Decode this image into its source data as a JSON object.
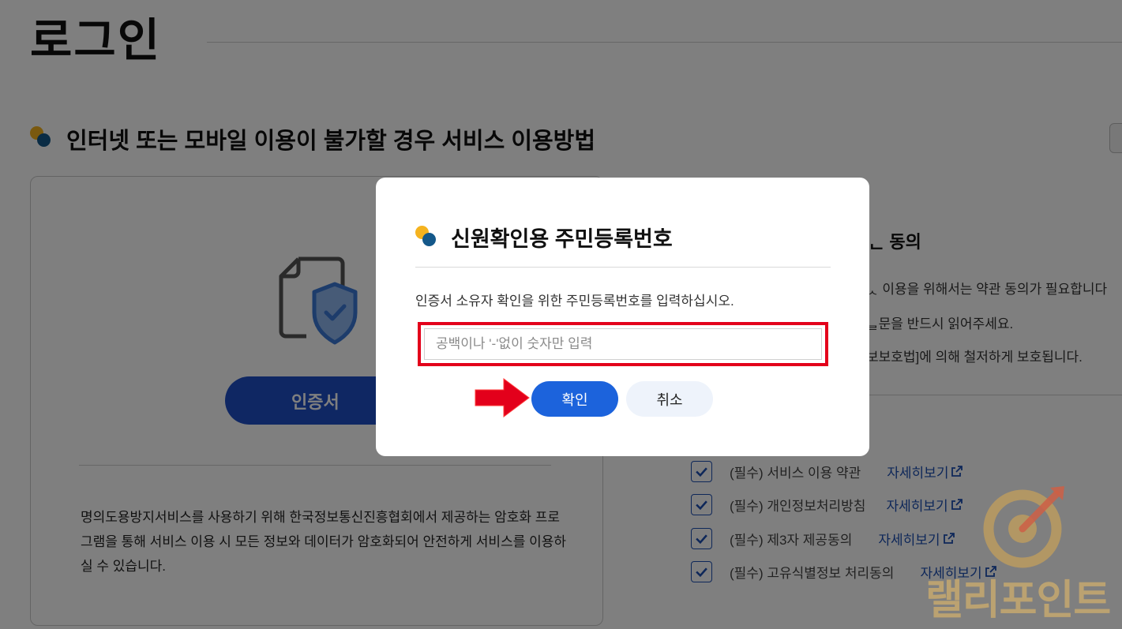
{
  "page": {
    "title": "로그인",
    "section_title": "인터넷 또는 모바일 이용이 불가할 경우 서비스 이용방법"
  },
  "left_card": {
    "button_label": "인증서",
    "description": "명의도용방지서비스를 사용하기 위해 한국정보통신진흥협회에서 제공하는 암호화 프로그램을 통해 서비스 이용 시 모든 정보와 데이터가 암호화되어 안전하게 서비스를 이용하실 수 있습니다."
  },
  "consent": {
    "title_fragment": "ᆫ 동의",
    "lines": [
      "ᆺ 이용을 위해서는 약관 동의가 필요합니다",
      "ᆯ문을 반드시 읽어주세요.",
      "보보호법]에 의해 철저하게 보호됩니다."
    ],
    "items": [
      {
        "label": "(필수) 서비스 이용 약관",
        "link": "자세히보기",
        "checked": true
      },
      {
        "label": "(필수) 개인정보처리방침",
        "link": "자세히보기",
        "checked": true
      },
      {
        "label": "(필수) 제3자 제공동의",
        "link": "자세히보기",
        "checked": true
      },
      {
        "label": "(필수) 고유식별정보 처리동의",
        "link": "자세히보기",
        "checked": true
      }
    ]
  },
  "modal": {
    "title": "신원확인용 주민등록번호",
    "description": "인증서 소유자 확인을 위한 주민등록번호를 입력하십시오.",
    "input_placeholder": "공백이나 '-'없이 숫자만 입력",
    "input_value": "",
    "confirm_label": "확인",
    "cancel_label": "취소"
  },
  "watermark": {
    "text": "랠리포인트"
  },
  "colors": {
    "accent_blue": "#1c63dc",
    "cert_button_blue": "#1f4fc7",
    "highlight_red": "#e3001b",
    "dot_yellow": "#f5b31f",
    "dot_navy": "#14588a"
  }
}
